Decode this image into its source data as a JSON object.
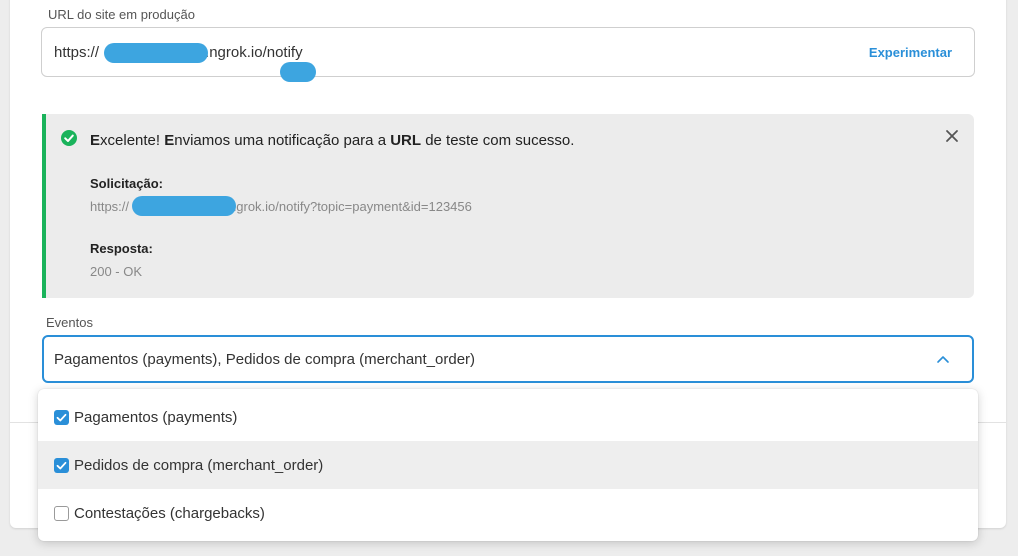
{
  "production_url": {
    "label": "URL do site em produção",
    "value_prefix": "https://",
    "value_suffix": ".ngrok.io/notify",
    "try_button": "Experimentar"
  },
  "alert": {
    "status": "success",
    "title_parts": [
      "E",
      "xcelente! ",
      "E",
      "nviamos uma notificação para a ",
      "URL",
      " de teste com sucesso."
    ],
    "request_label": "Solicitação:",
    "request_prefix": "https://",
    "request_suffix": "ngrok.io/notify?topic=payment&id=123456",
    "response_label": "Resposta:",
    "response_value": "200 - OK",
    "icons": {
      "status": "check-circle-icon",
      "close": "close-icon"
    }
  },
  "events": {
    "label": "Eventos",
    "selected_text": "Pagamentos (payments), Pedidos de compra (merchant_order)",
    "expanded": true,
    "options": [
      {
        "label": "Pagamentos (payments)",
        "checked": true
      },
      {
        "label": "Pedidos de compra (merchant_order)",
        "checked": true
      },
      {
        "label": "Contestações (chargebacks)",
        "checked": false
      }
    ]
  },
  "colors": {
    "accent": "#2a8fd8",
    "success": "#1ab35b",
    "redaction": "#3da5e0"
  }
}
